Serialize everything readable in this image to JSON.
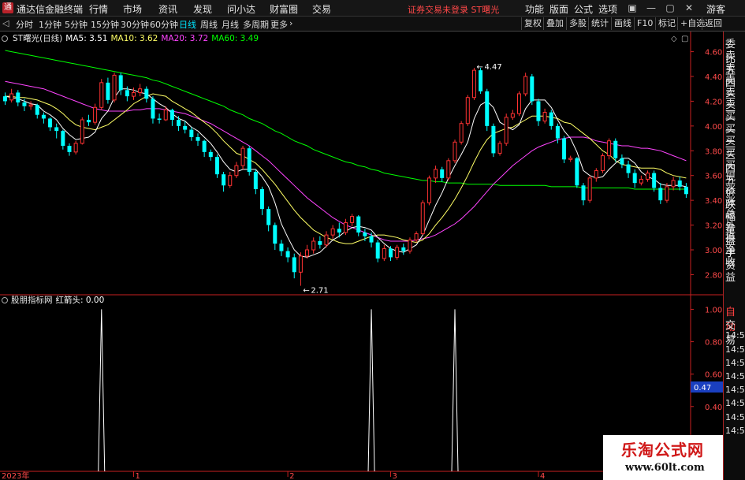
{
  "titlebar": {
    "logo_char": "通",
    "app_name": "通达信金融终端",
    "menu": [
      "行情",
      "市场",
      "资讯",
      "发现",
      "问小达",
      "财富圈",
      "交易"
    ],
    "notice": "证券交易未登录  ST曙光",
    "right_menu": [
      "功能",
      "版面",
      "公式",
      "选项"
    ],
    "window_icons": [
      "▣",
      "—",
      "▢",
      "✕"
    ],
    "guest": "游客"
  },
  "toolbar": {
    "periods": [
      "分时",
      "1分钟",
      "5分钟",
      "15分钟",
      "30分钟",
      "60分钟",
      "日线",
      "周线",
      "月线",
      "多周期",
      "更多"
    ],
    "active_period": "日线",
    "more_arrow": "›",
    "right_buttons": [
      "复权",
      "叠加",
      "多股",
      "统计",
      "画线",
      "F10",
      "标记",
      "+自选",
      "返回"
    ]
  },
  "main_legend": {
    "name": "ST曙光(日线)",
    "ma5": "MA5: 3.51",
    "ma10": "MA10: 3.62",
    "ma20": "MA20: 3.72",
    "ma60": "MA60: 3.49"
  },
  "indicator_legend": {
    "name": "股朋指标网",
    "label": "红箭头: 0.00"
  },
  "annotations": {
    "high": "4.47",
    "low": "2.71",
    "arrow": "←"
  },
  "crosshair_value": "0.47",
  "x_labels": [
    "2023年",
    "1",
    "2",
    "3",
    "4"
  ],
  "right_panel": {
    "labels": [
      "委比",
      "卖五",
      "卖四",
      "卖三",
      "卖二",
      "卖一",
      "买一",
      "买二",
      "买三",
      "买四",
      "买五",
      "现价",
      "涨跌",
      "涨幅",
      "总量",
      "外盘",
      "换手",
      "净资",
      "收益"
    ],
    "lower": [
      "自动",
      "交易",
      "14:56",
      "14:56",
      "14:56",
      "14:56",
      "14:56",
      "14:56",
      "14:56",
      "14:56"
    ]
  },
  "watermark": {
    "line1": "乐淘公式网",
    "line2": "www.60lt.com"
  },
  "colors": {
    "up": "#ff3232",
    "down": "#00ffff",
    "ma5": "#ffffff",
    "ma10": "#ffff66",
    "ma20": "#ff44ff",
    "ma60": "#00ff00",
    "axis_red": "#c82020"
  },
  "chart_data": {
    "type": "candlestick",
    "price_axis": {
      "ylim": [
        2.65,
        4.75
      ],
      "ticks": [
        "4.60",
        "4.40",
        "4.20",
        "4.00",
        "3.80",
        "3.60",
        "3.40",
        "3.20",
        "3.00",
        "2.80"
      ]
    },
    "indicator_axis": {
      "ylim": [
        0,
        1.08
      ],
      "ticks": [
        "1.00",
        "0.80",
        "0.60",
        "0.40",
        "0.20"
      ]
    },
    "candles": [
      [
        4.24,
        4.2,
        4.27,
        4.17
      ],
      [
        4.21,
        4.26,
        4.3,
        4.19
      ],
      [
        4.27,
        4.19,
        4.29,
        4.16
      ],
      [
        4.19,
        4.16,
        4.22,
        4.12
      ],
      [
        4.16,
        4.17,
        4.2,
        4.13
      ],
      [
        4.17,
        4.09,
        4.18,
        4.06
      ],
      [
        4.09,
        4.06,
        4.11,
        4.02
      ],
      [
        4.06,
        3.99,
        4.07,
        3.96
      ],
      [
        3.99,
        3.96,
        4.02,
        3.9
      ],
      [
        3.96,
        3.84,
        3.97,
        3.81
      ],
      [
        3.84,
        3.79,
        3.86,
        3.76
      ],
      [
        3.79,
        3.86,
        3.88,
        3.77
      ],
      [
        3.86,
        4.05,
        4.07,
        3.85
      ],
      [
        4.05,
        4.03,
        4.09,
        4.0
      ],
      [
        4.03,
        4.15,
        4.18,
        4.01
      ],
      [
        4.15,
        4.35,
        4.38,
        4.13
      ],
      [
        4.35,
        4.21,
        4.39,
        4.18
      ],
      [
        4.21,
        4.41,
        4.43,
        4.19
      ],
      [
        4.41,
        4.29,
        4.43,
        4.25
      ],
      [
        4.29,
        4.24,
        4.32,
        4.2
      ],
      [
        4.24,
        4.27,
        4.31,
        4.21
      ],
      [
        4.27,
        4.3,
        4.34,
        4.24
      ],
      [
        4.3,
        4.22,
        4.32,
        4.19
      ],
      [
        4.22,
        4.06,
        4.24,
        4.02
      ],
      [
        4.06,
        4.05,
        4.1,
        4.02
      ],
      [
        4.05,
        4.13,
        4.16,
        4.04
      ],
      [
        4.13,
        4.05,
        4.14,
        4.0
      ],
      [
        4.05,
        4.0,
        4.08,
        3.96
      ],
      [
        4.0,
        3.97,
        4.04,
        3.94
      ],
      [
        3.97,
        3.91,
        3.99,
        3.88
      ],
      [
        3.91,
        3.88,
        3.94,
        3.84
      ],
      [
        3.88,
        3.79,
        3.89,
        3.75
      ],
      [
        3.79,
        3.75,
        3.81,
        3.72
      ],
      [
        3.75,
        3.61,
        3.77,
        3.58
      ],
      [
        3.61,
        3.52,
        3.63,
        3.47
      ],
      [
        3.52,
        3.6,
        3.63,
        3.5
      ],
      [
        3.6,
        3.68,
        3.71,
        3.58
      ],
      [
        3.68,
        3.82,
        3.84,
        3.65
      ],
      [
        3.82,
        3.63,
        3.84,
        3.6
      ],
      [
        3.63,
        3.49,
        3.65,
        3.45
      ],
      [
        3.49,
        3.33,
        3.51,
        3.28
      ],
      [
        3.33,
        3.2,
        3.35,
        3.15
      ],
      [
        3.2,
        3.05,
        3.22,
        3.0
      ],
      [
        3.05,
        2.99,
        3.08,
        2.95
      ],
      [
        2.99,
        2.94,
        3.02,
        2.9
      ],
      [
        2.94,
        2.82,
        2.97,
        2.77
      ],
      [
        2.82,
        2.95,
        2.98,
        2.71
      ],
      [
        2.95,
        3.0,
        3.04,
        2.93
      ],
      [
        3.0,
        3.07,
        3.1,
        2.97
      ],
      [
        3.07,
        3.04,
        3.11,
        3.01
      ],
      [
        3.04,
        3.12,
        3.15,
        3.02
      ],
      [
        3.12,
        3.17,
        3.2,
        3.09
      ],
      [
        3.17,
        3.14,
        3.22,
        3.1
      ],
      [
        3.14,
        3.22,
        3.25,
        3.12
      ],
      [
        3.22,
        3.27,
        3.29,
        3.19
      ],
      [
        3.27,
        3.14,
        3.28,
        3.11
      ],
      [
        3.14,
        3.11,
        3.17,
        3.07
      ],
      [
        3.11,
        3.06,
        3.14,
        3.02
      ],
      [
        3.06,
        2.93,
        3.08,
        2.9
      ],
      [
        2.93,
        3.01,
        3.04,
        2.91
      ],
      [
        3.01,
        2.94,
        3.03,
        2.91
      ],
      [
        2.94,
        3.02,
        3.04,
        2.92
      ],
      [
        3.02,
        2.99,
        3.05,
        2.96
      ],
      [
        2.99,
        3.08,
        3.1,
        2.97
      ],
      [
        3.08,
        3.13,
        3.15,
        3.06
      ],
      [
        3.13,
        3.38,
        3.4,
        3.12
      ],
      [
        3.38,
        3.58,
        3.6,
        3.36
      ],
      [
        3.58,
        3.65,
        3.68,
        3.54
      ],
      [
        3.65,
        3.58,
        3.67,
        3.55
      ],
      [
        3.58,
        3.72,
        3.74,
        3.56
      ],
      [
        3.72,
        3.87,
        3.89,
        3.7
      ],
      [
        3.87,
        4.02,
        4.04,
        3.85
      ],
      [
        4.02,
        4.23,
        4.25,
        4.0
      ],
      [
        4.23,
        4.45,
        4.47,
        4.21
      ],
      [
        4.45,
        4.28,
        4.47,
        4.26
      ],
      [
        4.28,
        4.0,
        4.3,
        3.96
      ],
      [
        4.0,
        3.78,
        4.02,
        3.75
      ],
      [
        3.78,
        3.86,
        3.88,
        3.76
      ],
      [
        3.86,
        4.07,
        4.1,
        3.84
      ],
      [
        4.07,
        4.1,
        4.13,
        4.05
      ],
      [
        4.1,
        4.26,
        4.28,
        4.08
      ],
      [
        4.26,
        4.4,
        4.43,
        4.24
      ],
      [
        4.4,
        4.2,
        4.42,
        4.17
      ],
      [
        4.2,
        4.04,
        4.22,
        4.0
      ],
      [
        4.04,
        4.11,
        4.14,
        4.02
      ],
      [
        4.11,
        4.0,
        4.13,
        3.97
      ],
      [
        4.0,
        3.9,
        4.02,
        3.86
      ],
      [
        3.9,
        3.73,
        3.92,
        3.7
      ],
      [
        3.73,
        3.74,
        3.76,
        3.71
      ],
      [
        3.74,
        3.52,
        3.75,
        3.5
      ],
      [
        3.52,
        3.4,
        3.54,
        3.36
      ],
      [
        3.4,
        3.58,
        3.6,
        3.38
      ],
      [
        3.58,
        3.64,
        3.66,
        3.55
      ],
      [
        3.64,
        3.76,
        3.78,
        3.62
      ],
      [
        3.76,
        3.88,
        3.9,
        3.73
      ],
      [
        3.88,
        3.74,
        3.9,
        3.71
      ],
      [
        3.74,
        3.69,
        3.77,
        3.66
      ],
      [
        3.69,
        3.62,
        3.72,
        3.58
      ],
      [
        3.62,
        3.54,
        3.65,
        3.5
      ],
      [
        3.54,
        3.57,
        3.6,
        3.52
      ],
      [
        3.57,
        3.62,
        3.64,
        3.55
      ],
      [
        3.62,
        3.5,
        3.64,
        3.47
      ],
      [
        3.5,
        3.4,
        3.54,
        3.37
      ],
      [
        3.4,
        3.51,
        3.54,
        3.38
      ],
      [
        3.51,
        3.56,
        3.59,
        3.48
      ],
      [
        3.56,
        3.51,
        3.59,
        3.48
      ],
      [
        3.51,
        3.45,
        3.54,
        3.42
      ]
    ],
    "ma5": [
      4.24,
      4.23,
      4.22,
      4.2,
      4.18,
      4.17,
      4.12,
      4.09,
      4.05,
      3.98,
      3.93,
      3.89,
      3.9,
      3.91,
      3.95,
      4.06,
      4.12,
      4.23,
      4.3,
      4.3,
      4.29,
      4.27,
      4.26,
      4.22,
      4.18,
      4.15,
      4.1,
      4.06,
      4.04,
      3.99,
      3.96,
      3.91,
      3.86,
      3.79,
      3.71,
      3.65,
      3.63,
      3.65,
      3.65,
      3.65,
      3.59,
      3.51,
      3.38,
      3.21,
      3.1,
      3.0,
      2.95,
      2.94,
      2.96,
      2.98,
      3.03,
      3.08,
      3.11,
      3.15,
      3.18,
      3.19,
      3.18,
      3.16,
      3.1,
      3.05,
      3.01,
      2.99,
      2.98,
      3.01,
      3.04,
      3.12,
      3.24,
      3.36,
      3.46,
      3.58,
      3.68,
      3.77,
      3.87,
      4.06,
      4.17,
      4.2,
      4.15,
      4.03,
      4.0,
      3.97,
      4.01,
      4.14,
      4.21,
      4.21,
      4.21,
      4.15,
      4.05,
      3.96,
      3.9,
      3.79,
      3.64,
      3.6,
      3.58,
      3.59,
      3.65,
      3.7,
      3.74,
      3.74,
      3.7,
      3.63,
      3.59,
      3.57,
      3.53,
      3.52,
      3.52,
      3.52,
      3.51
    ],
    "ma10": [
      4.24,
      4.24,
      4.23,
      4.23,
      4.22,
      4.21,
      4.19,
      4.17,
      4.14,
      4.1,
      4.05,
      4.01,
      3.99,
      3.98,
      3.97,
      3.99,
      4.01,
      4.05,
      4.09,
      4.13,
      4.18,
      4.21,
      4.24,
      4.26,
      4.25,
      4.24,
      4.2,
      4.17,
      4.14,
      4.11,
      4.07,
      4.03,
      3.99,
      3.94,
      3.88,
      3.83,
      3.78,
      3.76,
      3.73,
      3.7,
      3.65,
      3.59,
      3.53,
      3.46,
      3.39,
      3.32,
      3.26,
      3.21,
      3.16,
      3.13,
      3.1,
      3.08,
      3.06,
      3.05,
      3.05,
      3.07,
      3.09,
      3.11,
      3.12,
      3.12,
      3.11,
      3.1,
      3.08,
      3.07,
      3.06,
      3.08,
      3.13,
      3.2,
      3.26,
      3.33,
      3.41,
      3.5,
      3.6,
      3.71,
      3.81,
      3.89,
      3.94,
      3.96,
      3.98,
      3.99,
      4.02,
      4.05,
      4.08,
      4.08,
      4.08,
      4.07,
      4.06,
      4.03,
      4.02,
      3.98,
      3.94,
      3.9,
      3.85,
      3.8,
      3.77,
      3.72,
      3.69,
      3.68,
      3.67,
      3.66,
      3.66,
      3.66,
      3.65,
      3.62,
      3.6,
      3.59,
      3.58
    ],
    "ma20": [
      4.36,
      4.35,
      4.34,
      4.33,
      4.32,
      4.31,
      4.3,
      4.28,
      4.26,
      4.24,
      4.22,
      4.2,
      4.18,
      4.16,
      4.14,
      4.13,
      4.12,
      4.12,
      4.12,
      4.12,
      4.13,
      4.13,
      4.14,
      4.14,
      4.14,
      4.13,
      4.12,
      4.11,
      4.1,
      4.08,
      4.06,
      4.04,
      4.02,
      3.99,
      3.96,
      3.93,
      3.9,
      3.87,
      3.84,
      3.8,
      3.76,
      3.72,
      3.67,
      3.62,
      3.57,
      3.52,
      3.47,
      3.42,
      3.38,
      3.34,
      3.3,
      3.26,
      3.23,
      3.2,
      3.18,
      3.16,
      3.14,
      3.12,
      3.1,
      3.08,
      3.07,
      3.07,
      3.07,
      3.07,
      3.08,
      3.09,
      3.1,
      3.12,
      3.15,
      3.18,
      3.21,
      3.25,
      3.3,
      3.35,
      3.41,
      3.47,
      3.53,
      3.58,
      3.63,
      3.68,
      3.72,
      3.76,
      3.8,
      3.83,
      3.85,
      3.87,
      3.89,
      3.9,
      3.91,
      3.91,
      3.91,
      3.9,
      3.88,
      3.87,
      3.86,
      3.85,
      3.84,
      3.84,
      3.83,
      3.82,
      3.82,
      3.81,
      3.8,
      3.78,
      3.76,
      3.74,
      3.72
    ],
    "ma60": [
      4.61,
      4.6,
      4.59,
      4.58,
      4.57,
      4.56,
      4.55,
      4.54,
      4.53,
      4.52,
      4.51,
      4.5,
      4.49,
      4.48,
      4.47,
      4.46,
      4.45,
      4.44,
      4.43,
      4.42,
      4.41,
      4.4,
      4.39,
      4.37,
      4.36,
      4.34,
      4.32,
      4.3,
      4.28,
      4.26,
      4.24,
      4.22,
      4.2,
      4.18,
      4.16,
      4.13,
      4.11,
      4.09,
      4.06,
      4.04,
      4.02,
      3.99,
      3.96,
      3.94,
      3.91,
      3.88,
      3.86,
      3.84,
      3.81,
      3.79,
      3.77,
      3.75,
      3.73,
      3.71,
      3.7,
      3.68,
      3.67,
      3.65,
      3.64,
      3.62,
      3.61,
      3.6,
      3.59,
      3.58,
      3.57,
      3.56,
      3.56,
      3.55,
      3.55,
      3.54,
      3.54,
      3.54,
      3.53,
      3.53,
      3.53,
      3.53,
      3.53,
      3.52,
      3.52,
      3.52,
      3.52,
      3.52,
      3.52,
      3.52,
      3.52,
      3.51,
      3.51,
      3.51,
      3.51,
      3.51,
      3.5,
      3.5,
      3.5,
      3.5,
      3.5,
      3.5,
      3.5,
      3.5,
      3.49,
      3.49,
      3.49,
      3.49,
      3.49,
      3.49,
      3.49,
      3.49,
      3.49
    ],
    "indicator": {
      "name": "红箭头",
      "spikes": [
        {
          "index": 15,
          "value": 1
        },
        {
          "index": 57,
          "value": 1
        },
        {
          "index": 70,
          "value": 1
        }
      ]
    },
    "annotations": [
      {
        "label": "4.47",
        "index": 73,
        "price": 4.47
      },
      {
        "label": "2.71",
        "index": 46,
        "price": 2.71
      }
    ]
  }
}
